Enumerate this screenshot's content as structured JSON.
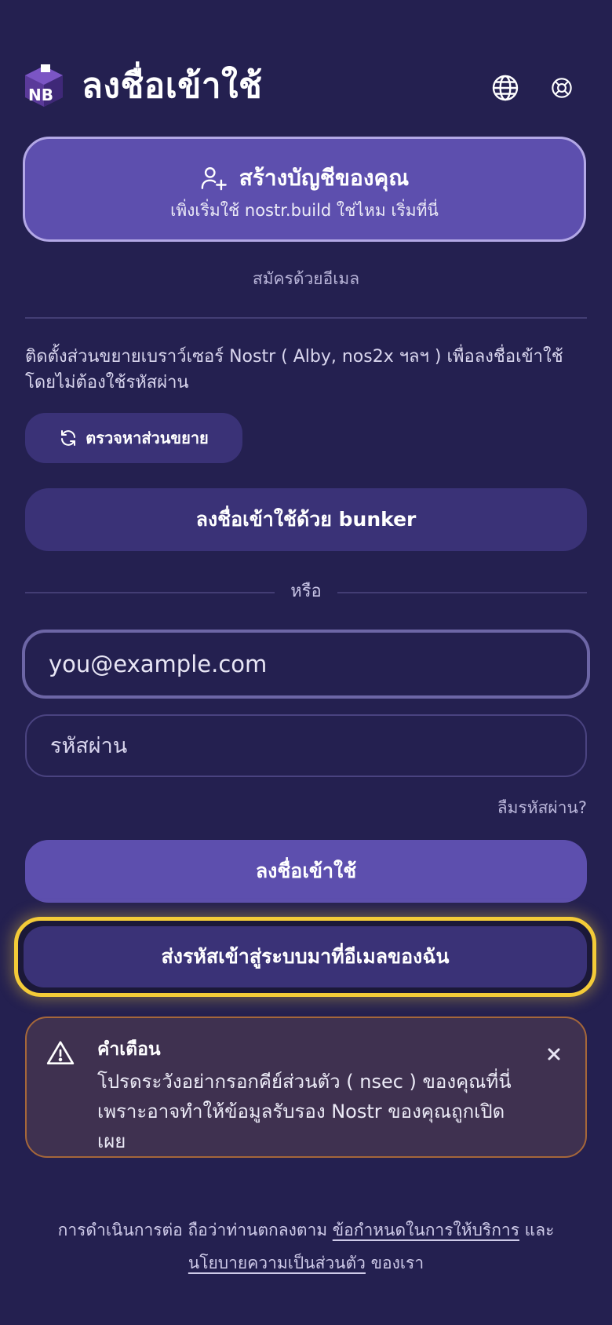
{
  "header": {
    "logo_text": "NB",
    "title": "ลงชื่อเข้าใช้",
    "language_icon": "globe-icon",
    "help_icon": "lifebuoy-icon"
  },
  "create_account": {
    "icon": "user-plus-icon",
    "title": "สร้างบัญชีของคุณ",
    "subtitle": "เพิ่งเริ่มใช้ nostr.build ใช่ไหม เริ่มที่นี่"
  },
  "email_signup_link": "สมัครด้วยอีเมล",
  "extension": {
    "description": "ติดตั้งส่วนขยายเบราว์เซอร์ Nostr ( Alby, nos2x ฯลฯ ) เพื่อลงชื่อเข้าใช้โดยไม่ต้องใช้รหัสผ่าน",
    "detect_icon": "refresh-icon",
    "detect_label": "ตรวจหาส่วนขยาย"
  },
  "bunker_label": "ลงชื่อเข้าใช้ด้วย bunker",
  "or_label": "หรือ",
  "form": {
    "email_placeholder": "you@example.com",
    "password_placeholder": "รหัสผ่าน",
    "forgot_label": "ลืมรหัสผ่าน?",
    "login_label": "ลงชื่อเข้าใช้",
    "email_code_label": "ส่งรหัสเข้าสู่ระบบมาที่อีเมลของฉัน"
  },
  "warning": {
    "icon": "warning-triangle-icon",
    "title": "คำเตือน",
    "body": "โปรดระวังอย่ากรอกคีย์ส่วนตัว ( nsec ) ของคุณที่นี่ เพราะอาจทำให้ข้อมูลรับรอง Nostr ของคุณถูกเปิดเผย",
    "close_icon": "close-icon"
  },
  "terms": {
    "prefix": "การดำเนินการต่อ ถือว่าท่านตกลงตาม",
    "tos_link": "ข้อกำหนดในการให้บริการ",
    "and": "และ",
    "privacy_link": "นโยบายความเป็นส่วนตัว",
    "suffix": "ของเรา"
  },
  "colors": {
    "background": "#242050",
    "primary_button": "#5d4fae",
    "secondary_button": "#3a3277",
    "highlight_border": "#f4cb38",
    "warning_border": "#a5673a"
  }
}
